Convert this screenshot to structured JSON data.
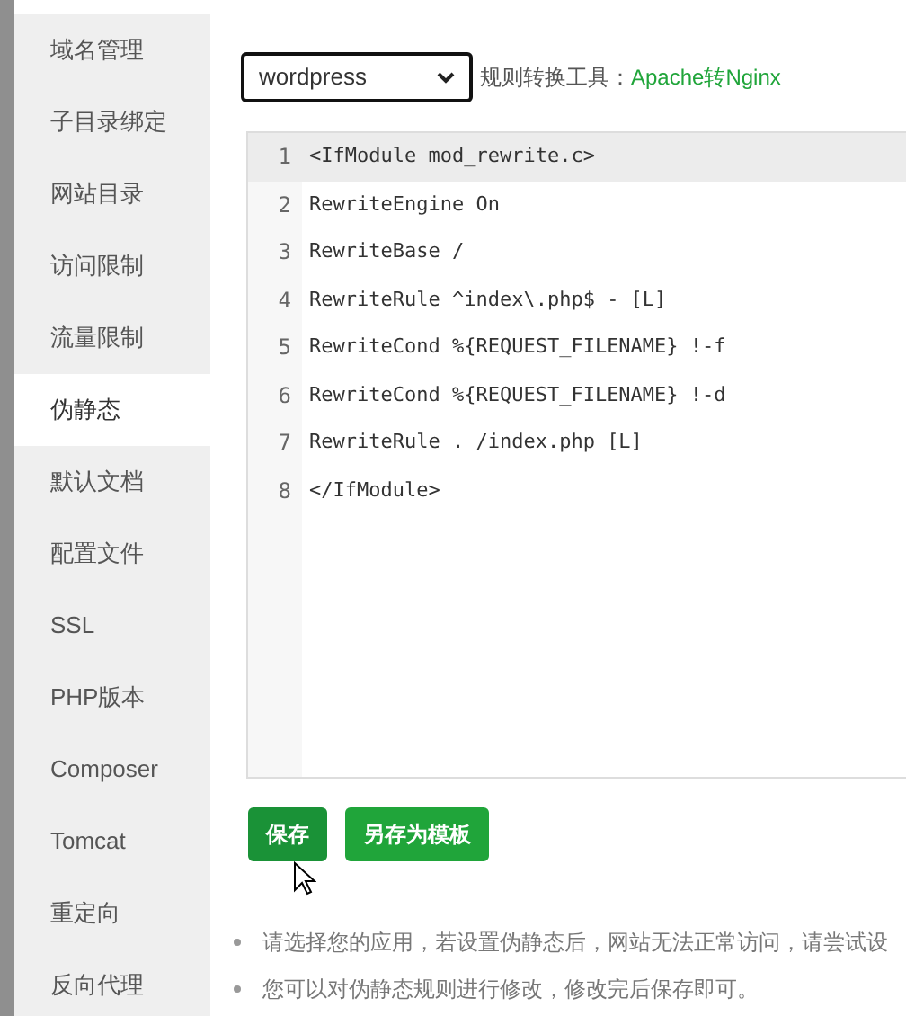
{
  "sidebar": {
    "items": [
      {
        "label": "域名管理",
        "selected": false
      },
      {
        "label": "子目录绑定",
        "selected": false
      },
      {
        "label": "网站目录",
        "selected": false
      },
      {
        "label": "访问限制",
        "selected": false
      },
      {
        "label": "流量限制",
        "selected": false
      },
      {
        "label": "伪静态",
        "selected": true
      },
      {
        "label": "默认文档",
        "selected": false
      },
      {
        "label": "配置文件",
        "selected": false
      },
      {
        "label": "SSL",
        "selected": false
      },
      {
        "label": "PHP版本",
        "selected": false
      },
      {
        "label": "Composer",
        "selected": false
      },
      {
        "label": "Tomcat",
        "selected": false
      },
      {
        "label": "重定向",
        "selected": false
      },
      {
        "label": "反向代理",
        "selected": false
      }
    ]
  },
  "template_select": {
    "value": "wordpress"
  },
  "converter": {
    "label": "规则转换工具：",
    "link": "Apache转Nginx"
  },
  "editor": {
    "lines": [
      {
        "number": "1",
        "text": "<IfModule mod_rewrite.c>",
        "selected": true
      },
      {
        "number": "2",
        "text": "RewriteEngine On",
        "selected": false
      },
      {
        "number": "3",
        "text": "RewriteBase /",
        "selected": false
      },
      {
        "number": "4",
        "text": "RewriteRule ^index\\.php$ - [L]",
        "selected": false
      },
      {
        "number": "5",
        "text": "RewriteCond %{REQUEST_FILENAME} !-f",
        "selected": false
      },
      {
        "number": "6",
        "text": "RewriteCond %{REQUEST_FILENAME} !-d",
        "selected": false
      },
      {
        "number": "7",
        "text": "RewriteRule . /index.php [L]",
        "selected": false
      },
      {
        "number": "8",
        "text": "</IfModule>",
        "selected": false
      }
    ]
  },
  "buttons": [
    {
      "label": "保存",
      "kind": "primary"
    },
    {
      "label": "另存为模板",
      "kind": "secondary"
    }
  ],
  "notes": [
    "请选择您的应用，若设置伪静态后，网站无法正常访问，请尝试设",
    "您可以对伪静态规则进行修改，修改完后保存即可。"
  ]
}
